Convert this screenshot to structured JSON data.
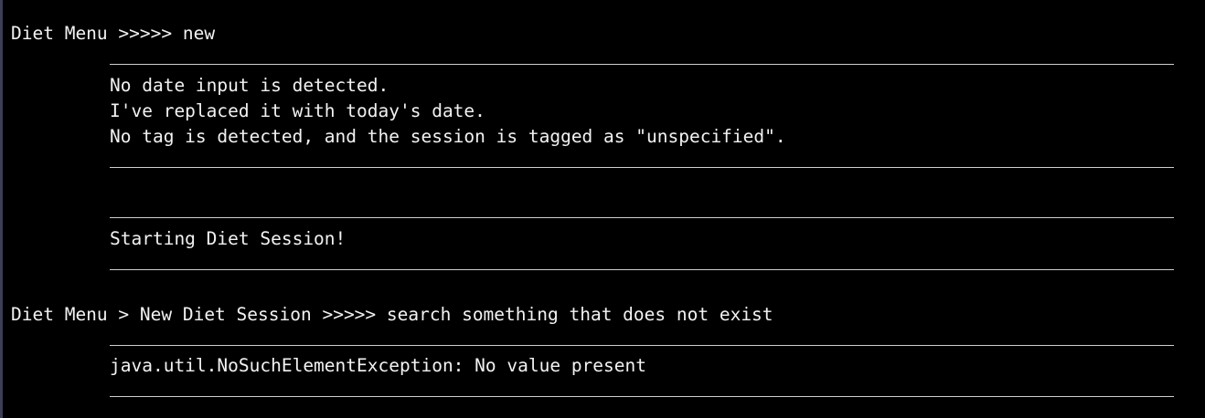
{
  "terminal": {
    "colors": {
      "background": "#000000",
      "foreground": "#f2f2f2",
      "left_edge": "#3a3f55"
    },
    "prompt1": {
      "text": "Diet Menu >>>>> new"
    },
    "block1": {
      "lines": [
        "No date input is detected.",
        "I've replaced it with today's date.",
        "No tag is detected, and the session is tagged as \"unspecified\"."
      ]
    },
    "block2": {
      "lines": [
        "Starting Diet Session!"
      ]
    },
    "prompt2": {
      "text": "Diet Menu > New Diet Session >>>>> search something that does not exist"
    },
    "block3": {
      "lines": [
        "java.util.NoSuchElementException: No value present"
      ]
    }
  }
}
